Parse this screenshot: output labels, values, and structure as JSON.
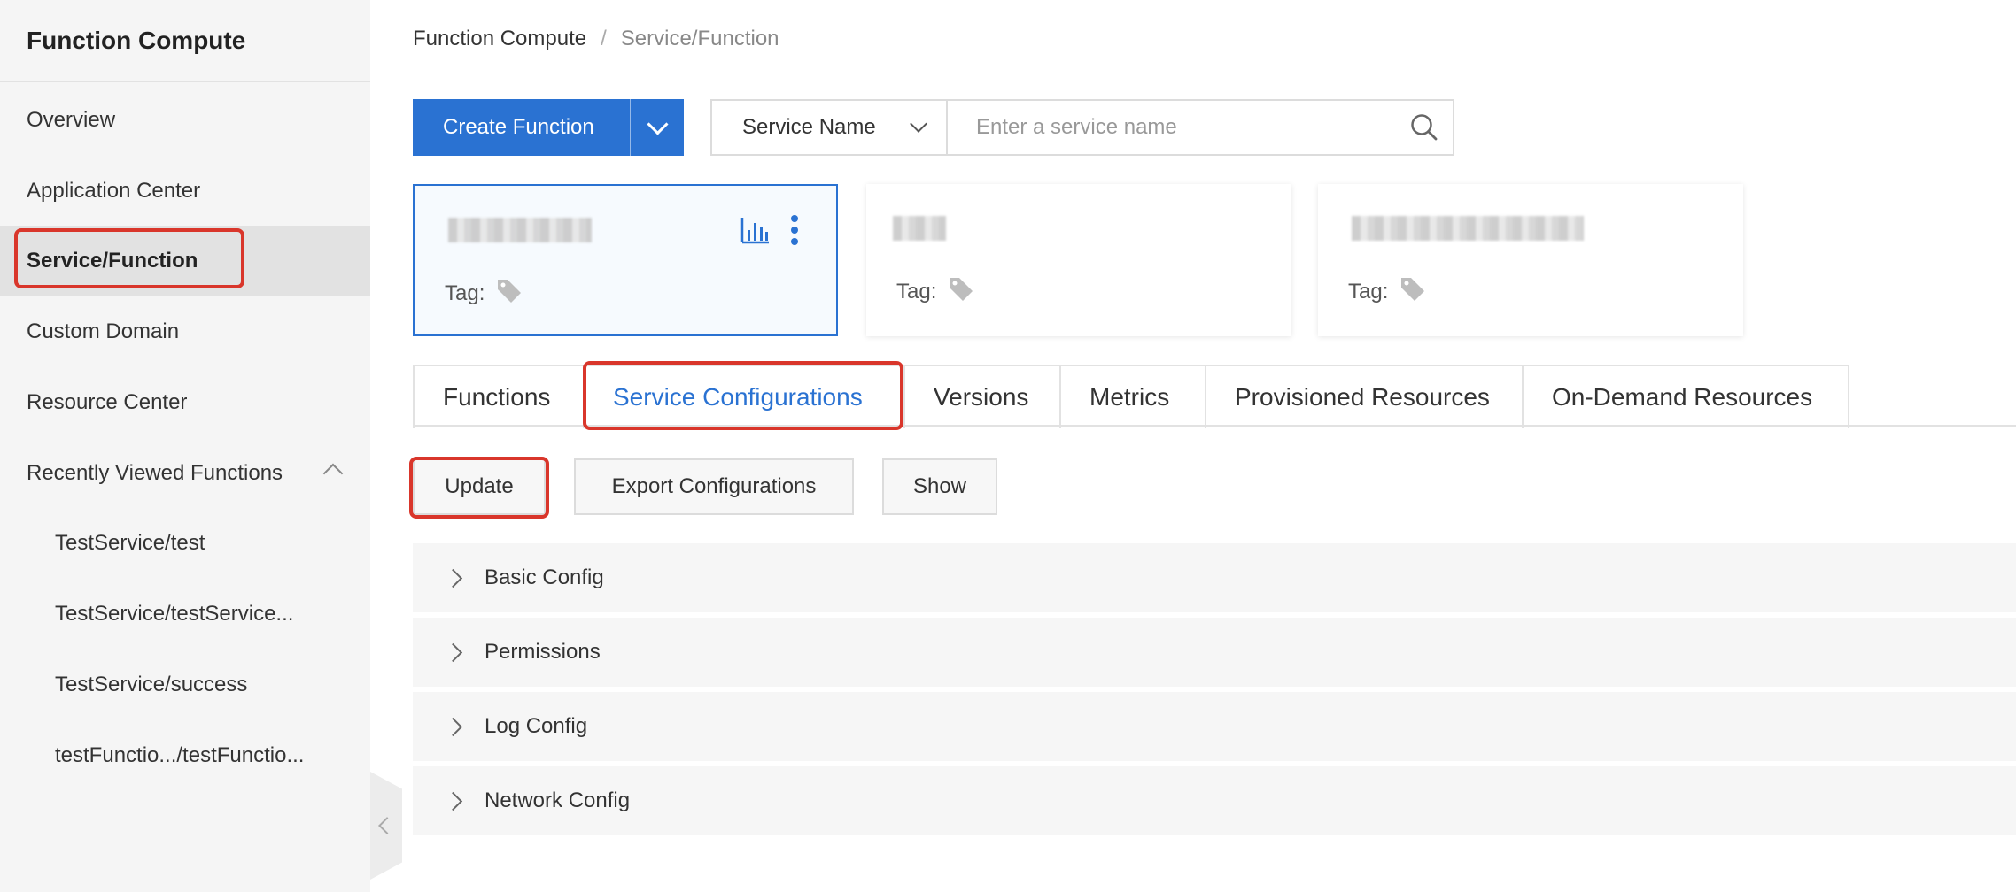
{
  "sidebar": {
    "title": "Function Compute",
    "items": [
      {
        "label": "Overview"
      },
      {
        "label": "Application Center"
      },
      {
        "label": "Service/Function"
      },
      {
        "label": "Custom Domain"
      },
      {
        "label": "Resource Center"
      },
      {
        "label": "Recently Viewed Functions"
      }
    ],
    "recent": [
      {
        "label": "TestService/test"
      },
      {
        "label": "TestService/testService..."
      },
      {
        "label": "TestService/success"
      },
      {
        "label": "testFunctio.../testFunctio..."
      }
    ],
    "active_item": "Service/Function"
  },
  "breadcrumb": {
    "root": "Function Compute",
    "separator": "/",
    "current": "Service/Function"
  },
  "toolbar": {
    "create_label": "Create Function",
    "search_field_label": "Service Name",
    "search_placeholder": "Enter a service name"
  },
  "cards": [
    {
      "tag_label": "Tag:",
      "selected": true
    },
    {
      "tag_label": "Tag:",
      "selected": false
    },
    {
      "tag_label": "Tag:",
      "selected": false
    }
  ],
  "tabs": [
    {
      "label": "Functions"
    },
    {
      "label": "Service Configurations"
    },
    {
      "label": "Versions"
    },
    {
      "label": "Metrics"
    },
    {
      "label": "Provisioned Resources"
    },
    {
      "label": "On-Demand Resources"
    }
  ],
  "active_tab": "Service Configurations",
  "actions": {
    "update_label": "Update",
    "export_label": "Export Configurations",
    "show_label": "Show"
  },
  "panels": [
    {
      "label": "Basic Config"
    },
    {
      "label": "Permissions"
    },
    {
      "label": "Log Config"
    },
    {
      "label": "Network Config"
    }
  ],
  "colors": {
    "accent": "#2a72d2",
    "annotation": "#d9362b",
    "sidebar_bg": "#f5f5f5",
    "active_bg": "#e2e2e2"
  },
  "icons": {
    "search": "search-icon",
    "tag": "tag-icon",
    "monitor": "bar-chart-icon",
    "more": "more-vertical-icon"
  }
}
